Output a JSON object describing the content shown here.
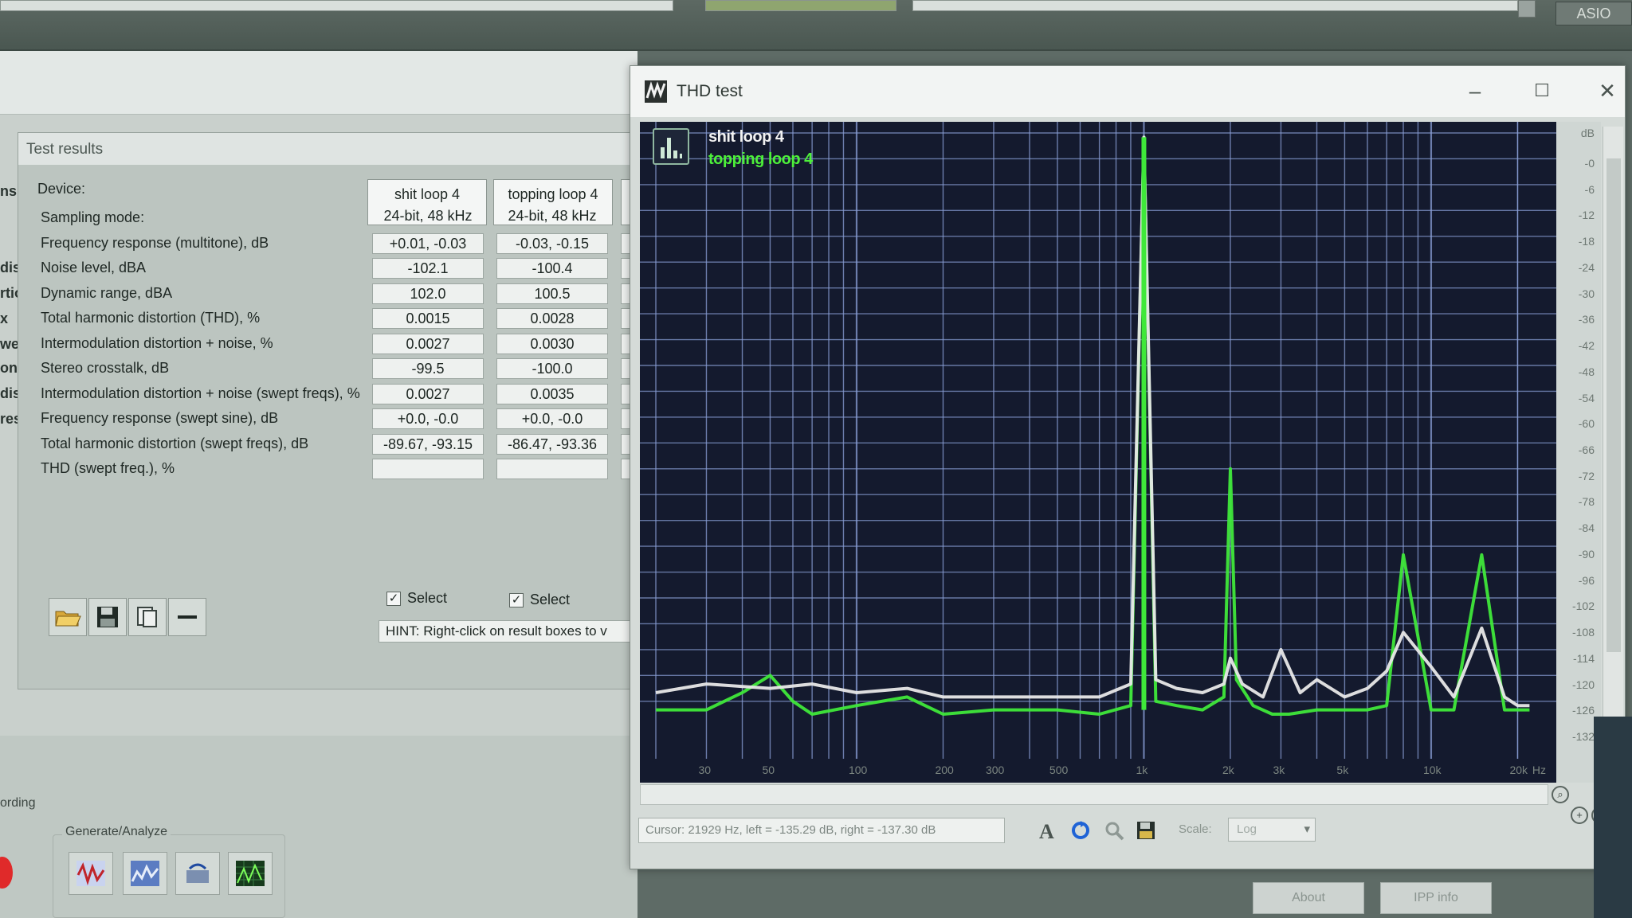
{
  "topbar": {
    "asio_label": "ASIO"
  },
  "side_labels": [
    "ns",
    "dist",
    "rtio",
    "x",
    "we",
    "ons",
    "dist",
    "resi"
  ],
  "main": {
    "recording_label": "ording",
    "generate_group_label": "Generate/Analyze"
  },
  "results": {
    "title": "Test results",
    "device_label": "Device:",
    "devices": [
      "shit loop 4",
      "topping loop 4"
    ],
    "rows": [
      {
        "label": "Sampling mode:",
        "values": [
          "24-bit, 48 kHz",
          "24-bit, 48 kHz"
        ],
        "boxed": false
      },
      {
        "label": "Frequency response (multitone), dB",
        "values": [
          "+0.01, -0.03",
          "-0.03, -0.15"
        ],
        "boxed": true
      },
      {
        "label": "Noise level, dBA",
        "values": [
          "-102.1",
          "-100.4"
        ],
        "boxed": true
      },
      {
        "label": "Dynamic range, dBA",
        "values": [
          "102.0",
          "100.5"
        ],
        "boxed": true
      },
      {
        "label": "Total harmonic distortion (THD), %",
        "values": [
          "0.0015",
          "0.0028"
        ],
        "boxed": true
      },
      {
        "label": "Intermodulation distortion + noise, %",
        "values": [
          "0.0027",
          "0.0030"
        ],
        "boxed": true
      },
      {
        "label": "Stereo crosstalk, dB",
        "values": [
          "-99.5",
          "-100.0"
        ],
        "boxed": true
      },
      {
        "label": "Intermodulation distortion + noise (swept freqs), %",
        "values": [
          "0.0027",
          "0.0035"
        ],
        "boxed": true
      },
      {
        "label": "Frequency response (swept sine), dB",
        "values": [
          "+0.0, -0.0",
          "+0.0, -0.0"
        ],
        "boxed": true
      },
      {
        "label": "Total harmonic distortion (swept freqs), dB",
        "values": [
          "-89.67, -93.15",
          "-86.47, -93.36"
        ],
        "boxed": true
      },
      {
        "label": "THD (swept freq.), %",
        "values": [
          "",
          ""
        ],
        "boxed": true
      }
    ],
    "select_label": "Select",
    "hint": "HINT: Right-click on result boxes to v"
  },
  "thd": {
    "title": "THD test",
    "legend": [
      "shit loop 4",
      "topping loop 4"
    ],
    "cursor_text": "Cursor: 21929 Hz, left = -135.29 dB, right = -137.30 dB",
    "scale_label": "Scale:",
    "scale_value": "Log",
    "db_unit": "dB",
    "db_labels": [
      "-0",
      "-6",
      "-12",
      "-18",
      "-24",
      "-30",
      "-36",
      "-42",
      "-48",
      "-54",
      "-60",
      "-66",
      "-72",
      "-78",
      "-84",
      "-90",
      "-96",
      "-102",
      "-108",
      "-114",
      "-120",
      "-126",
      "-132"
    ],
    "freq_labels": [
      "30",
      "50",
      "100",
      "200",
      "300",
      "500",
      "1k",
      "2k",
      "3k",
      "5k",
      "10k",
      "20k",
      "Hz"
    ],
    "colors": {
      "series_a": "#e8e8e8",
      "series_b": "#3fe83a",
      "grid": "#8a9fd6",
      "background": "#141a2e"
    }
  },
  "bottom_buttons": [
    "About",
    "IPP info"
  ],
  "chart_data": {
    "type": "line",
    "title": "",
    "xlabel": "Hz",
    "ylabel": "dB",
    "xscale": "log",
    "xlim": [
      20,
      24000
    ],
    "ylim": [
      -135,
      0
    ],
    "grid": true,
    "legend_position": "top-left",
    "series": [
      {
        "name": "shit loop 4",
        "color": "#e8e8e8",
        "x": [
          20,
          30,
          50,
          70,
          100,
          150,
          200,
          300,
          500,
          700,
          900,
          1000,
          1100,
          1300,
          1600,
          1900,
          2000,
          2200,
          2600,
          3000,
          3500,
          4000,
          5000,
          6000,
          7000,
          8000,
          10000,
          12000,
          15000,
          18000,
          20000,
          22000
        ],
        "values": [
          -130,
          -128,
          -129,
          -128,
          -130,
          -129,
          -131,
          -131,
          -131,
          -131,
          -128,
          -1,
          -127,
          -129,
          -130,
          -128,
          -122,
          -128,
          -131,
          -120,
          -130,
          -127,
          -131,
          -129,
          -125,
          -116,
          -124,
          -131,
          -115,
          -131,
          -133,
          -133
        ]
      },
      {
        "name": "topping loop 4",
        "color": "#3fe83a",
        "x": [
          20,
          30,
          40,
          50,
          60,
          70,
          100,
          150,
          200,
          300,
          500,
          700,
          900,
          1000,
          1100,
          1300,
          1600,
          1900,
          2000,
          2100,
          2400,
          2800,
          3200,
          4000,
          5000,
          6000,
          7000,
          8000,
          10000,
          12000,
          15000,
          18000,
          20000,
          22000
        ],
        "values": [
          -134,
          -134,
          -130,
          -126,
          -132,
          -135,
          -133,
          -131,
          -135,
          -134,
          -134,
          -135,
          -133,
          -1,
          -132,
          -133,
          -134,
          -131,
          -78,
          -127,
          -133,
          -135,
          -135,
          -134,
          -134,
          -134,
          -133,
          -98,
          -134,
          -134,
          -98,
          -134,
          -134,
          -134
        ]
      }
    ]
  }
}
